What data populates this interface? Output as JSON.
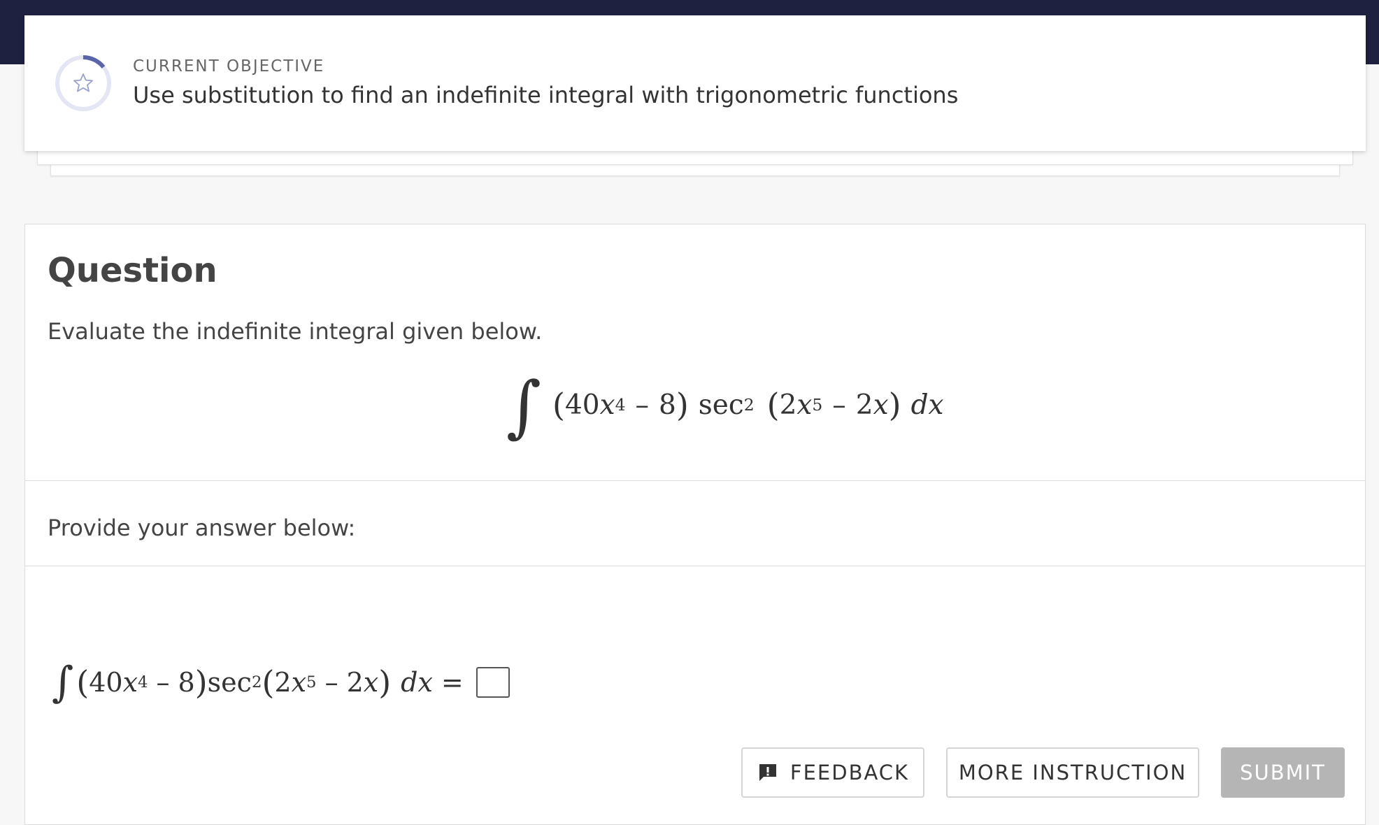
{
  "objective": {
    "label": "CURRENT OBJECTIVE",
    "text": "Use substitution to find an indefinite integral with trigonometric functions",
    "icon": "star-icon",
    "ring_color": "#5965a8",
    "ring_track_color": "#e4e6f4"
  },
  "question": {
    "title": "Question",
    "prompt": "Evaluate the indefinite integral given below.",
    "integral": {
      "symbol": "∫",
      "coef_a": "40",
      "var": "x",
      "exp_a": "4",
      "minus": "–",
      "const_b": "8",
      "func": "sec",
      "func_exp": "2",
      "coef_c": "2",
      "exp_c": "5",
      "coef_d": "2",
      "diff": "dx",
      "lparen": "(",
      "rparen": ")"
    }
  },
  "answer": {
    "prompt": "Provide your answer below:",
    "equals": "="
  },
  "buttons": {
    "feedback": "FEEDBACK",
    "more_instruction": "MORE INSTRUCTION",
    "submit": "SUBMIT"
  }
}
